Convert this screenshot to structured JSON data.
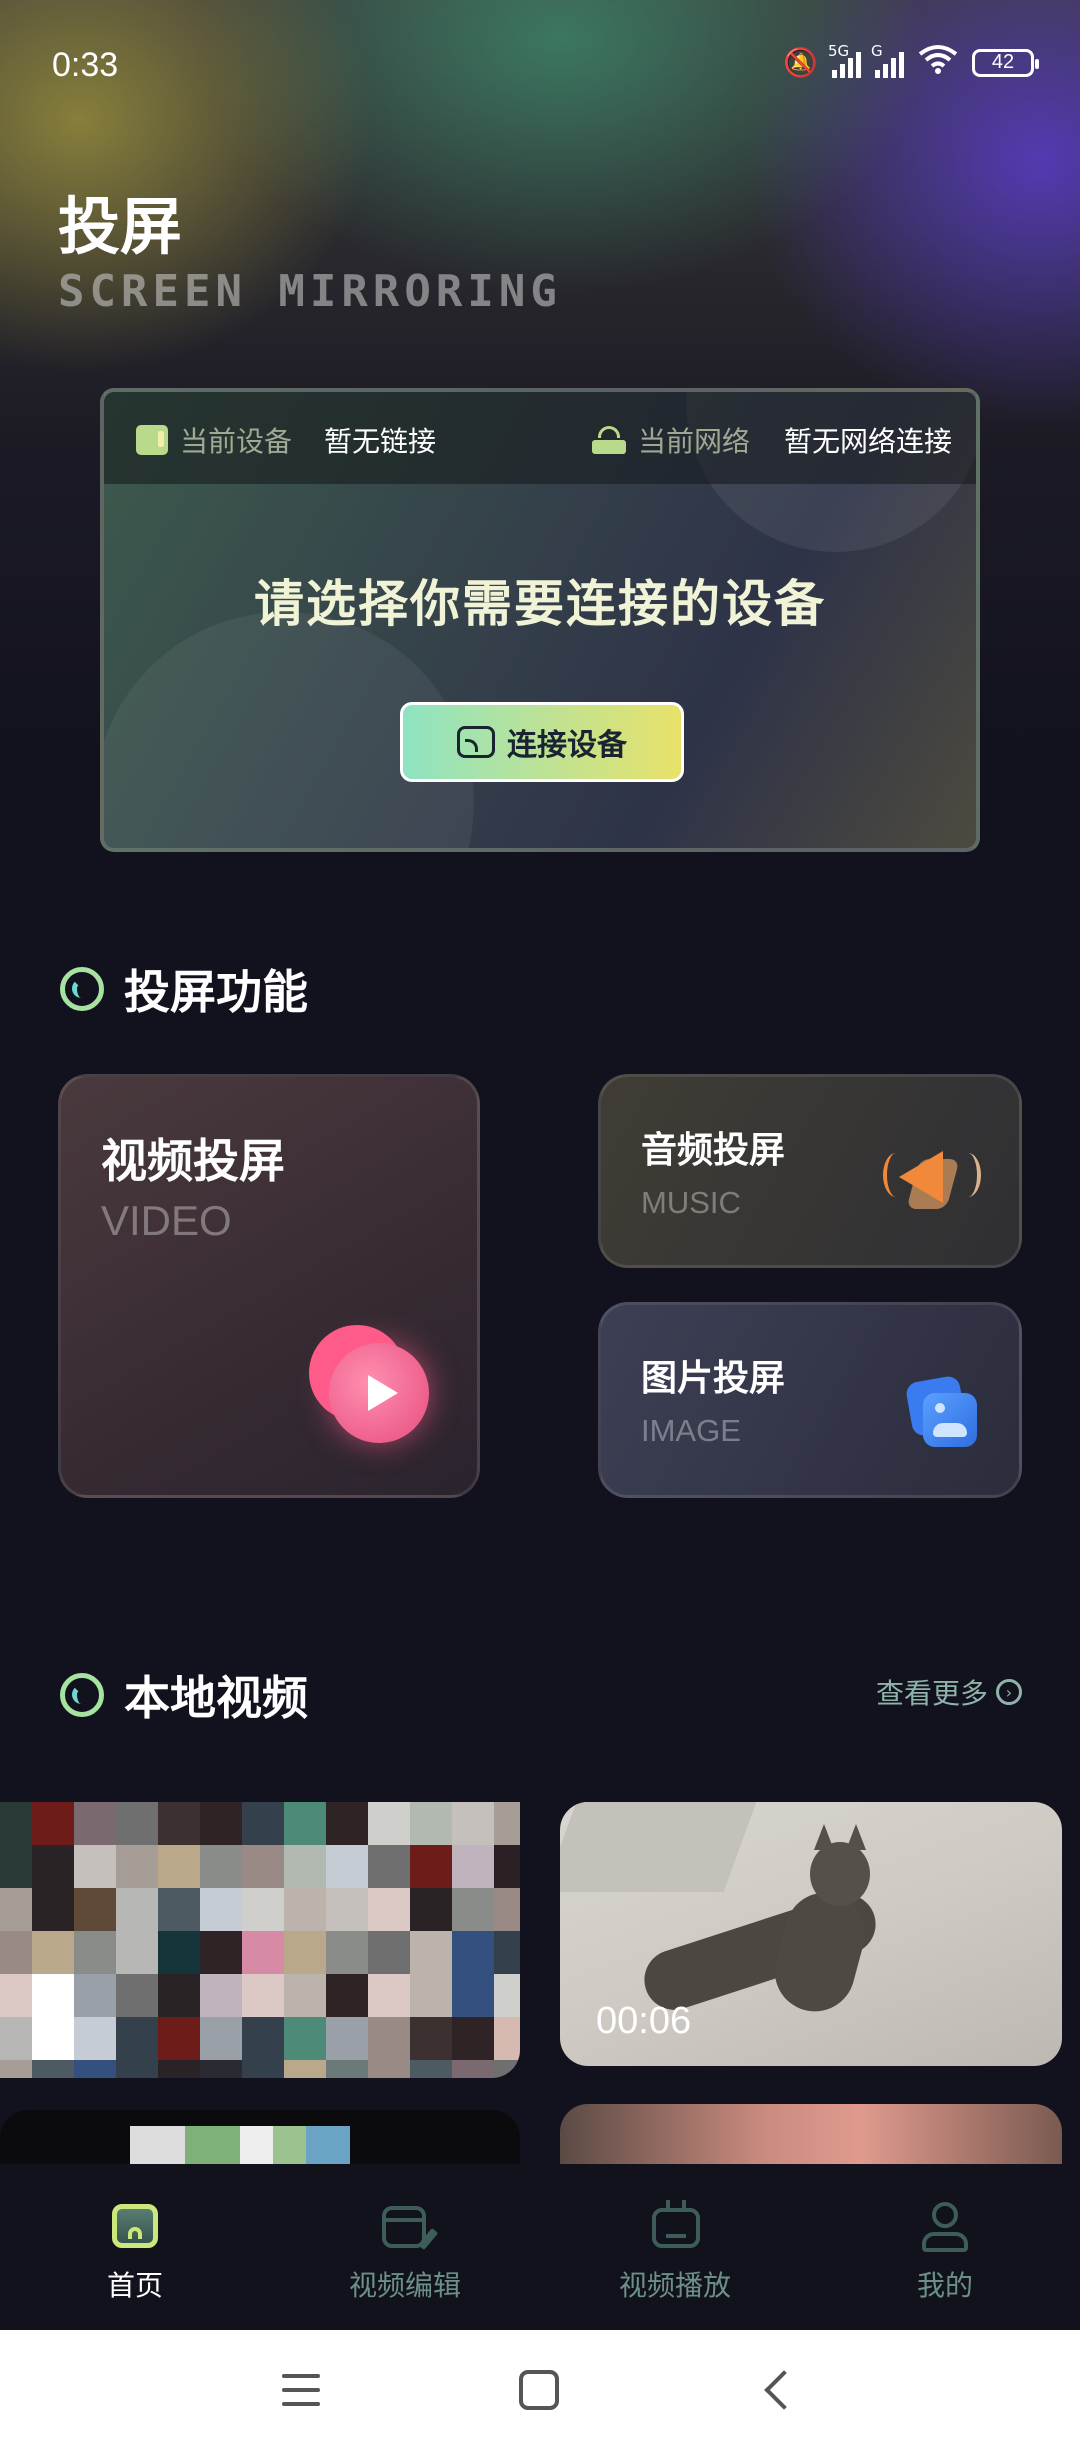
{
  "status_bar": {
    "time": "0:33",
    "network1": "5G",
    "network2": "G",
    "battery": "42"
  },
  "header": {
    "title": "投屏",
    "subtitle": "SCREEN MIRRORING"
  },
  "device_card": {
    "device_label": "当前设备",
    "device_value": "暂无链接",
    "network_label": "当前网络",
    "network_value": "暂无网络连接",
    "prompt": "请选择你需要连接的设备",
    "connect_button": "连接设备"
  },
  "cast_section": {
    "title": "投屏功能",
    "cards": [
      {
        "title": "视频投屏",
        "subtitle": "VIDEO",
        "icon": "play-icon"
      },
      {
        "title": "音频投屏",
        "subtitle": "MUSIC",
        "icon": "speaker-icon"
      },
      {
        "title": "图片投屏",
        "subtitle": "IMAGE",
        "icon": "image-icon"
      }
    ]
  },
  "local_videos": {
    "title": "本地视频",
    "see_more": "查看更多",
    "items": [
      {
        "duration": ""
      },
      {
        "duration": "00:06"
      }
    ]
  },
  "bottom_nav": {
    "items": [
      {
        "label": "首页",
        "icon": "home-icon",
        "active": true
      },
      {
        "label": "视频编辑",
        "icon": "video-edit-icon",
        "active": false
      },
      {
        "label": "视频播放",
        "icon": "tv-icon",
        "active": false
      },
      {
        "label": "我的",
        "icon": "profile-icon",
        "active": false
      }
    ]
  },
  "colors": {
    "accent_green": "#cde87a",
    "inactive_nav": "#6b8f89",
    "button_gradient_start": "#8fe3c2",
    "button_gradient_end": "#e8e26a"
  }
}
